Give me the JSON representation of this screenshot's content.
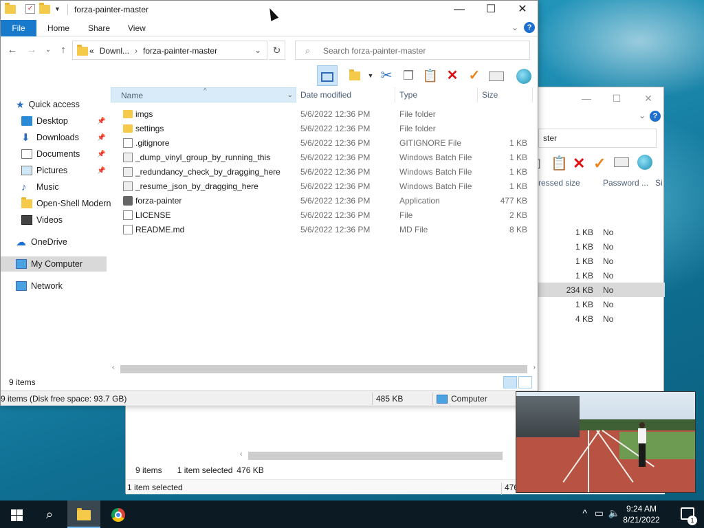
{
  "main_window": {
    "title": "forza-painter-master",
    "ribbon_tabs": [
      "File",
      "Home",
      "Share",
      "View"
    ],
    "address": {
      "prefix": "«",
      "crumbs": [
        "Downl...",
        "forza-painter-master"
      ]
    },
    "search_placeholder": "Search forza-painter-master",
    "columns": {
      "name": "Name",
      "date": "Date modified",
      "type": "Type",
      "size": "Size"
    },
    "files": [
      {
        "name": "imgs",
        "date": "5/6/2022 12:36 PM",
        "type": "File folder",
        "size": "",
        "icon": "folder-icon"
      },
      {
        "name": "settings",
        "date": "5/6/2022 12:36 PM",
        "type": "File folder",
        "size": "",
        "icon": "folder-icon"
      },
      {
        "name": ".gitignore",
        "date": "5/6/2022 12:36 PM",
        "type": "GITIGNORE File",
        "size": "1 KB",
        "icon": "file-icon"
      },
      {
        "name": "_dump_vinyl_group_by_running_this",
        "date": "5/6/2022 12:36 PM",
        "type": "Windows Batch File",
        "size": "1 KB",
        "icon": "batch-file-icon"
      },
      {
        "name": "_redundancy_check_by_dragging_here",
        "date": "5/6/2022 12:36 PM",
        "type": "Windows Batch File",
        "size": "1 KB",
        "icon": "batch-file-icon"
      },
      {
        "name": "_resume_json_by_dragging_here",
        "date": "5/6/2022 12:36 PM",
        "type": "Windows Batch File",
        "size": "1 KB",
        "icon": "batch-file-icon"
      },
      {
        "name": "forza-painter",
        "date": "5/6/2022 12:36 PM",
        "type": "Application",
        "size": "477 KB",
        "icon": "application-icon"
      },
      {
        "name": "LICENSE",
        "date": "5/6/2022 12:36 PM",
        "type": "File",
        "size": "2 KB",
        "icon": "file-icon"
      },
      {
        "name": "README.md",
        "date": "5/6/2022 12:36 PM",
        "type": "MD File",
        "size": "8 KB",
        "icon": "file-icon"
      }
    ],
    "status_items": "9 items",
    "bottom_status": {
      "left": "9 items (Disk free space: 93.7 GB)",
      "size": "485 KB",
      "location": "Computer"
    }
  },
  "nav_pane": {
    "quick_access": "Quick access",
    "pinned": [
      "Desktop",
      "Downloads",
      "Documents",
      "Pictures"
    ],
    "others": [
      "Music",
      "Open-Shell Modern",
      "Videos"
    ],
    "onedrive": "OneDrive",
    "my_computer": "My Computer",
    "network": "Network"
  },
  "back_window": {
    "search_partial": "ster",
    "columns": {
      "compressed": "ressed size",
      "password": "Password ...",
      "size": "Si"
    },
    "rows": [
      {
        "size": "1 KB",
        "password": "No"
      },
      {
        "size": "1 KB",
        "password": "No"
      },
      {
        "size": "1 KB",
        "password": "No"
      },
      {
        "size": "1 KB",
        "password": "No"
      },
      {
        "size": "234 KB",
        "password": "No",
        "selected": true
      },
      {
        "size": "1 KB",
        "password": "No"
      },
      {
        "size": "4 KB",
        "password": "No"
      }
    ],
    "status_items": "9 items",
    "status_selected": "1 item selected",
    "status_selected_size": "476 KB",
    "bottom_left": "1 item selected",
    "bottom_right": "476"
  },
  "taskbar": {
    "time": "9:24 AM",
    "date": "8/21/2022",
    "notification_count": "1"
  },
  "colors": {
    "accent": "#1979ca",
    "selection": "#cce4f7"
  }
}
